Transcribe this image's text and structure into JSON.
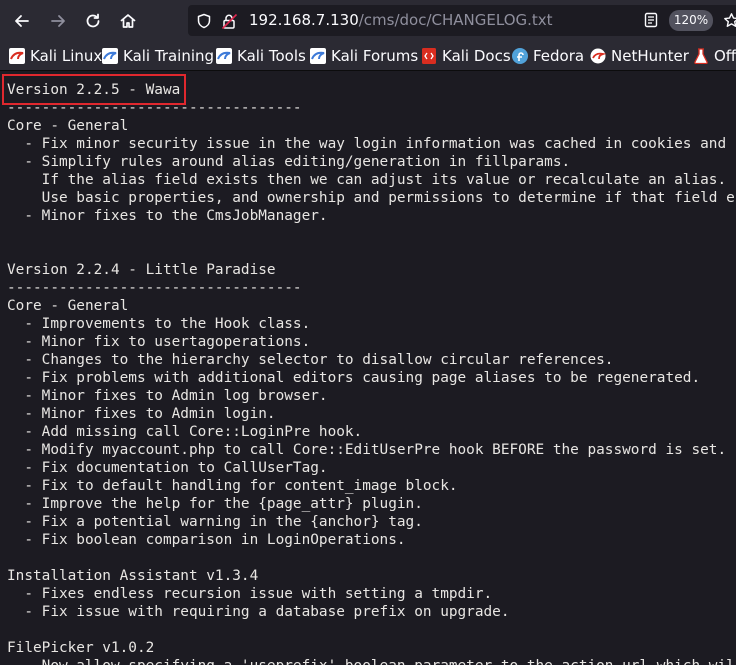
{
  "browser": {
    "url_host": "192.168.7.130",
    "url_path": "/cms/doc/CHANGELOG.txt",
    "zoom": "120%"
  },
  "bookmarks": [
    {
      "label": "Kali Linux",
      "icon": "kali-icon"
    },
    {
      "label": "Kali Training",
      "icon": "kali-icon"
    },
    {
      "label": "Kali Tools",
      "icon": "kali-icon"
    },
    {
      "label": "Kali Forums",
      "icon": "kali-icon"
    },
    {
      "label": "Kali Docs",
      "icon": "kali-docs-icon"
    },
    {
      "label": "Fedora",
      "icon": "fedora-icon"
    },
    {
      "label": "NetHunter",
      "icon": "nethunter-icon"
    },
    {
      "label": "Offe",
      "icon": "offsec-icon"
    }
  ],
  "document": {
    "lines": [
      "Version 2.2.5 - Wawa",
      "----------------------------------",
      "Core - General",
      "  - Fix minor security issue in the way login information was cached in cookies and",
      "  - Simplify rules around alias editing/generation in fillparams.",
      "    If the alias field exists then we can adjust its value or recalculate an alias.",
      "    Use basic properties, and ownership and permissions to determine if that field e",
      "  - Minor fixes to the CmsJobManager.",
      "",
      "",
      "Version 2.2.4 - Little Paradise",
      "----------------------------------",
      "Core - General",
      "  - Improvements to the Hook class.",
      "  - Minor fix to usertagoperations.",
      "  - Changes to the hierarchy selector to disallow circular references.",
      "  - Fix problems with additional editors causing page aliases to be regenerated.",
      "  - Minor fixes to Admin log browser.",
      "  - Minor fixes to Admin login.",
      "  - Add missing call Core::LoginPre hook.",
      "  - Modify myaccount.php to call Core::EditUserPre hook BEFORE the password is set.",
      "  - Fix documentation to CallUserTag.",
      "  - Fix to default handling for content_image block.",
      "  - Improve the help for the {page_attr} plugin.",
      "  - Fix a potential warning in the {anchor} tag.",
      "  - Fix boolean comparison in LoginOperations.",
      "",
      "Installation Assistant v1.3.4",
      "  - Fixes endless recursion issue with setting a tmpdir.",
      "  - Fix issue with requiring a database prefix on upgrade.",
      "",
      "FilePicker v1.0.2",
      "  - Now allow specifying a 'useprefix' boolean parameter to the action url which wil"
    ]
  },
  "colors": {
    "toolbar_bg": "#2b2a33",
    "content_bg": "#1c1b22",
    "text": "#e8e6e3",
    "highlight": "#e0282e",
    "kali_red": "#d92d20",
    "kali_blue": "#3d7ad8",
    "fedora_blue": "#51a2da"
  }
}
